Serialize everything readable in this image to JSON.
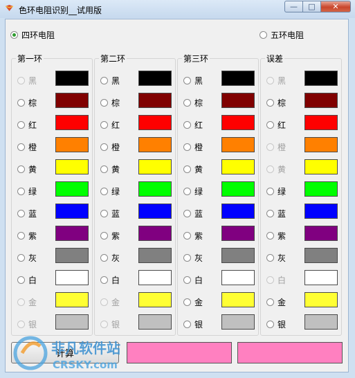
{
  "window": {
    "title": "色环电阻识别__试用版",
    "controls": {
      "minimize": "—",
      "maximize": "□",
      "close": "✕"
    }
  },
  "mode": {
    "options": [
      {
        "label": "四环电阻",
        "checked": true
      },
      {
        "label": "五环电阻",
        "checked": false
      }
    ]
  },
  "colors": {
    "黑": "#000000",
    "棕": "#800000",
    "红": "#ff0000",
    "橙": "#ff8000",
    "黄": "#ffff00",
    "绿": "#00ff00",
    "蓝": "#0000ff",
    "紫": "#800080",
    "灰": "#808080",
    "白": "#ffffff",
    "金": "#ffff33",
    "银": "#c0c0c0"
  },
  "groups": [
    {
      "title": "第一环",
      "rows": [
        {
          "label": "黑",
          "enabled": false
        },
        {
          "label": "棕",
          "enabled": true
        },
        {
          "label": "红",
          "enabled": true
        },
        {
          "label": "橙",
          "enabled": true
        },
        {
          "label": "黄",
          "enabled": true
        },
        {
          "label": "绿",
          "enabled": true
        },
        {
          "label": "蓝",
          "enabled": true
        },
        {
          "label": "紫",
          "enabled": true
        },
        {
          "label": "灰",
          "enabled": true
        },
        {
          "label": "白",
          "enabled": true
        },
        {
          "label": "金",
          "enabled": false
        },
        {
          "label": "银",
          "enabled": false
        }
      ]
    },
    {
      "title": "第二环",
      "rows": [
        {
          "label": "黑",
          "enabled": true
        },
        {
          "label": "棕",
          "enabled": true
        },
        {
          "label": "红",
          "enabled": true
        },
        {
          "label": "橙",
          "enabled": true
        },
        {
          "label": "黄",
          "enabled": true
        },
        {
          "label": "绿",
          "enabled": true
        },
        {
          "label": "蓝",
          "enabled": true
        },
        {
          "label": "紫",
          "enabled": true
        },
        {
          "label": "灰",
          "enabled": true
        },
        {
          "label": "白",
          "enabled": true
        },
        {
          "label": "金",
          "enabled": false
        },
        {
          "label": "银",
          "enabled": false
        }
      ]
    },
    {
      "title": "第三环",
      "rows": [
        {
          "label": "黑",
          "enabled": true
        },
        {
          "label": "棕",
          "enabled": true
        },
        {
          "label": "红",
          "enabled": true
        },
        {
          "label": "橙",
          "enabled": true
        },
        {
          "label": "黄",
          "enabled": true
        },
        {
          "label": "绿",
          "enabled": true
        },
        {
          "label": "蓝",
          "enabled": true
        },
        {
          "label": "紫",
          "enabled": true
        },
        {
          "label": "灰",
          "enabled": true
        },
        {
          "label": "白",
          "enabled": true
        },
        {
          "label": "金",
          "enabled": true
        },
        {
          "label": "银",
          "enabled": true
        }
      ]
    },
    {
      "title": "误差",
      "rows": [
        {
          "label": "黑",
          "enabled": false
        },
        {
          "label": "棕",
          "enabled": true
        },
        {
          "label": "红",
          "enabled": true
        },
        {
          "label": "橙",
          "enabled": false
        },
        {
          "label": "黄",
          "enabled": false
        },
        {
          "label": "绿",
          "enabled": true
        },
        {
          "label": "蓝",
          "enabled": true
        },
        {
          "label": "紫",
          "enabled": true
        },
        {
          "label": "灰",
          "enabled": true
        },
        {
          "label": "白",
          "enabled": false
        },
        {
          "label": "金",
          "enabled": true
        },
        {
          "label": "银",
          "enabled": true
        }
      ]
    }
  ],
  "bottom": {
    "button_label": "计算",
    "result_box_colors": [
      "#ff80c0",
      "#ff80c0"
    ]
  },
  "watermark": {
    "line1": "非凡软件站",
    "line2": "CRSKY.com"
  }
}
